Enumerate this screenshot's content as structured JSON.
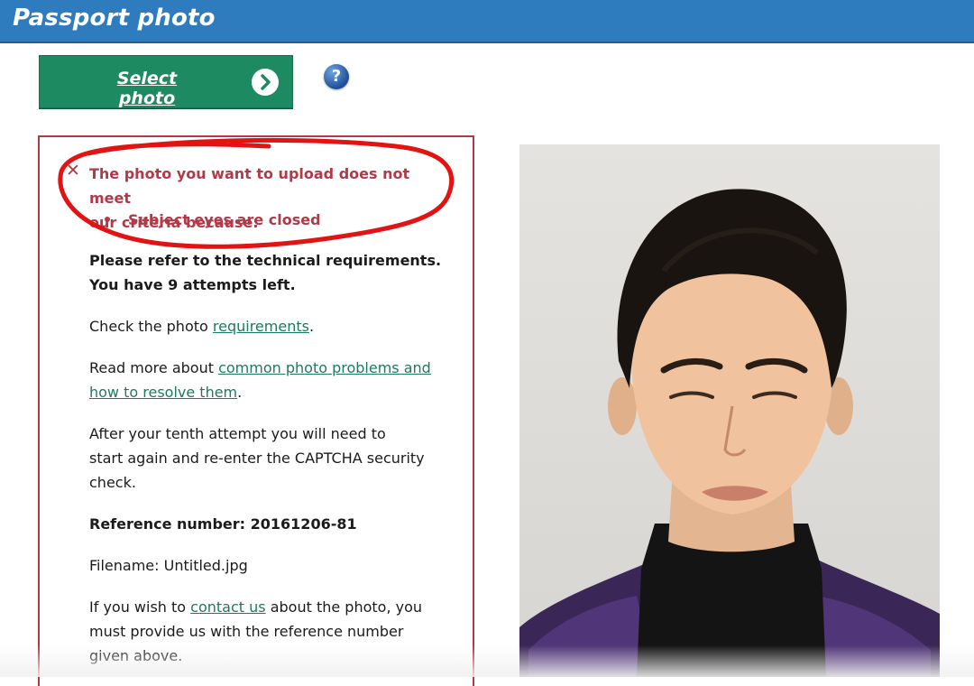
{
  "header": {
    "title": "Passport photo"
  },
  "toolbar": {
    "select_label": "Select photo",
    "help_label": "?"
  },
  "error": {
    "close_icon": "close-x-icon",
    "close_glyph": "✕",
    "line1": "The photo you want to upload does not meet",
    "line2": "our criteria because:",
    "reason": "Subject eyes are closed"
  },
  "content": {
    "req_line1": "Please refer to the technical requirements.",
    "req_line2": "You have 9 attempts left.",
    "check_prefix": "Check the photo ",
    "check_link": "requirements",
    "check_suffix": ".",
    "readmore_prefix": "Read more about ",
    "readmore_link_a": "common photo problems and",
    "readmore_link_b": "how to resolve them",
    "readmore_suffix": ".",
    "after_line1": "After your tenth attempt you will need to",
    "after_line2": "start again and re-enter the CAPTCHA security",
    "after_line3": "check.",
    "ref_label": "Reference number: 20161206-81",
    "filename": "Filename: Untitled.jpg",
    "contact_prefix": "If you wish to ",
    "contact_link": "contact us",
    "contact_suffix": " about the photo, you",
    "contact_line2": "must provide us with the reference number",
    "contact_line3": "given above."
  },
  "colors": {
    "header_bg": "#2e7bbd",
    "button_bg": "#1e8a62",
    "error_red": "#b23a48",
    "link_green": "#1e7a5d"
  }
}
